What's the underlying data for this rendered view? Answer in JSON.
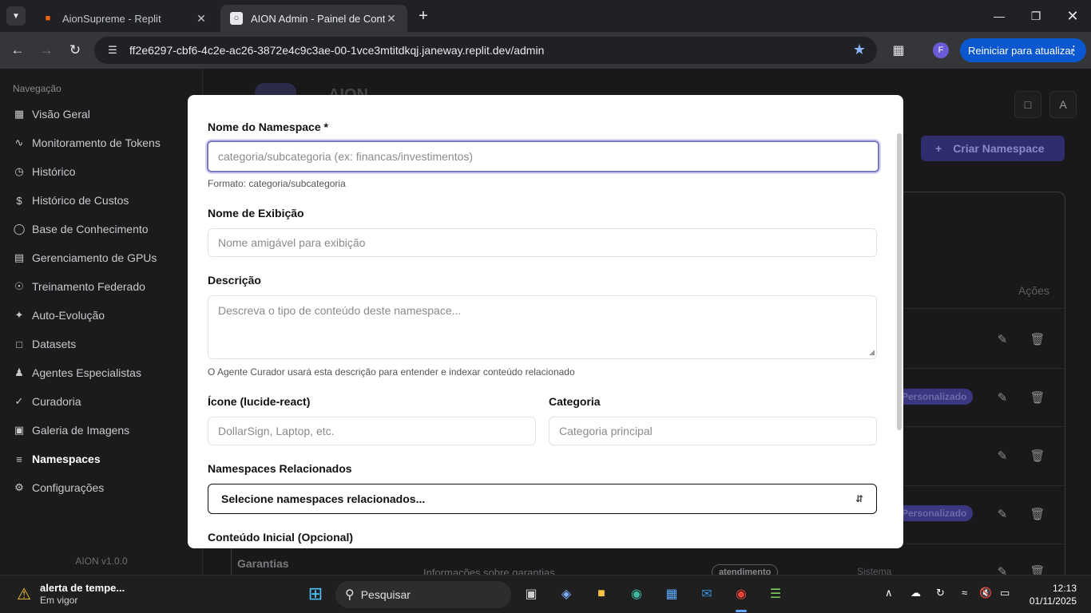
{
  "browser": {
    "tabs": [
      {
        "title": "AionSupreme - Replit",
        "icon": "replit-icon",
        "active": false
      },
      {
        "title": "AION Admin - Painel de Controle",
        "icon": "aion-icon",
        "active": true
      }
    ],
    "url": "ff2e6297-cbf6-4c2e-ac26-3872e4c9c3ae-00-1vce3mtitdkqj.janeway.replit.dev/admin",
    "profile_initial": "F",
    "update_label": "Reiniciar para atualizar",
    "accent": "#0b57d0"
  },
  "sidebar": {
    "heading": "Navegação",
    "items": [
      {
        "label": "Visão Geral",
        "icon": "grid-icon"
      },
      {
        "label": "Monitoramento de Tokens",
        "icon": "activity-icon"
      },
      {
        "label": "Histórico",
        "icon": "clock-icon"
      },
      {
        "label": "Histórico de Custos",
        "icon": "dollar-icon"
      },
      {
        "label": "Base de Conhecimento",
        "icon": "database-icon"
      },
      {
        "label": "Gerenciamento de GPUs",
        "icon": "server-icon"
      },
      {
        "label": "Treinamento Federado",
        "icon": "network-icon"
      },
      {
        "label": "Auto-Evolução",
        "icon": "sparkles-icon"
      },
      {
        "label": "Datasets",
        "icon": "file-icon"
      },
      {
        "label": "Agentes Especialistas",
        "icon": "users-icon"
      },
      {
        "label": "Curadoria",
        "icon": "check-icon"
      },
      {
        "label": "Galeria de Imagens",
        "icon": "image-icon"
      },
      {
        "label": "Namespaces",
        "icon": "folder-icon",
        "active": true
      },
      {
        "label": "Configurações",
        "icon": "gear-icon"
      }
    ],
    "version": "AION v1.0.0"
  },
  "main": {
    "brand": "AION",
    "create_button": "Criar Namespace",
    "table_actions_header": "Ações",
    "rows_visible_badges": [
      "Personalizado",
      "Personalizado"
    ],
    "last_row": {
      "name": "Garantias",
      "description": "Informações sobre garantias",
      "category": "atendimento",
      "type": "Sistema"
    }
  },
  "modal": {
    "namespace_label": "Nome do Namespace *",
    "namespace_placeholder": "categoria/subcategoria (ex: financas/investimentos)",
    "namespace_hint": "Formato: categoria/subcategoria",
    "display_label": "Nome de Exibição",
    "display_placeholder": "Nome amigável para exibição",
    "description_label": "Descrição",
    "description_placeholder": "Descreva o tipo de conteúdo deste namespace...",
    "description_hint": "O Agente Curador usará esta descrição para entender e indexar conteúdo relacionado",
    "icon_label": "Ícone (lucide-react)",
    "icon_placeholder": "DollarSign, Laptop, etc.",
    "category_label": "Categoria",
    "category_placeholder": "Categoria principal",
    "related_label": "Namespaces Relacionados",
    "related_select": "Selecione namespaces relacionados...",
    "initial_content_label": "Conteúdo Inicial (Opcional)"
  },
  "taskbar": {
    "weather_title": "alerta de tempe...",
    "weather_sub": "Em vigor",
    "search_label": "Pesquisar",
    "time": "12:13",
    "date": "01/11/2025"
  }
}
